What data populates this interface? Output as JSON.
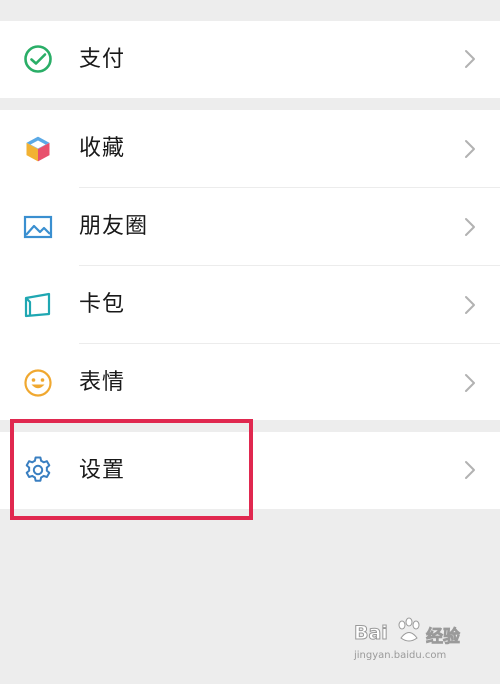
{
  "menu": {
    "pay": {
      "label": "支付",
      "icon": "wechat-pay-icon"
    },
    "favorites": {
      "label": "收藏",
      "icon": "cube-icon"
    },
    "moments": {
      "label": "朋友圈",
      "icon": "image-icon"
    },
    "cards": {
      "label": "卡包",
      "icon": "card-wallet-icon"
    },
    "stickers": {
      "label": "表情",
      "icon": "smiley-icon"
    },
    "settings": {
      "label": "设置",
      "icon": "gear-icon"
    }
  },
  "highlight_target": "settings",
  "colors": {
    "background": "#ededed",
    "row": "#ffffff",
    "highlight_border": "#e0284f",
    "pay_green": "#2aae67",
    "moments_blue": "#3a8fd0",
    "cards_teal": "#1fa7b2",
    "stickers_yellow": "#f0a830",
    "settings_blue": "#3a7fc1"
  },
  "watermark": {
    "brand": "Bai",
    "brand_suffix": "经验",
    "url": "jingyan.baidu.com"
  }
}
